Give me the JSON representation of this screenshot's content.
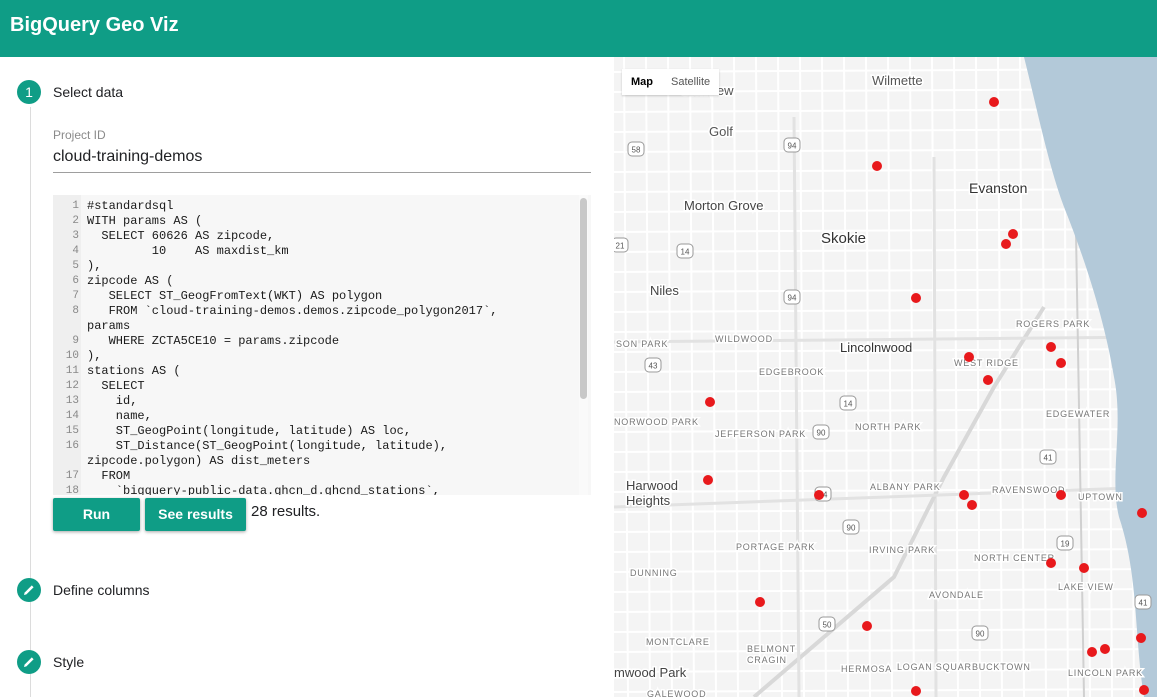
{
  "app": {
    "title": "BigQuery Geo Viz"
  },
  "steps": [
    {
      "number": "1",
      "label": "Select data"
    },
    {
      "label": "Define columns"
    },
    {
      "label": "Style"
    }
  ],
  "project": {
    "label": "Project ID",
    "value": "cloud-training-demos"
  },
  "editor": {
    "lines": [
      {
        "n": "1",
        "text": "#standardsql"
      },
      {
        "n": "2",
        "text": "WITH params AS ("
      },
      {
        "n": "3",
        "text": "  SELECT 60626 AS zipcode,"
      },
      {
        "n": "4",
        "text": "         10    AS maxdist_km"
      },
      {
        "n": "5",
        "text": "),"
      },
      {
        "n": "6",
        "text": "zipcode AS ("
      },
      {
        "n": "7",
        "text": "   SELECT ST_GeogFromText(WKT) AS polygon"
      },
      {
        "n": "8",
        "text": "   FROM `cloud-training-demos.demos.zipcode_polygon2017`,"
      },
      {
        "n": "",
        "text": "params"
      },
      {
        "n": "9",
        "text": "   WHERE ZCTA5CE10 = params.zipcode"
      },
      {
        "n": "10",
        "text": "),"
      },
      {
        "n": "11",
        "text": "stations AS ("
      },
      {
        "n": "12",
        "text": "  SELECT"
      },
      {
        "n": "13",
        "text": "    id,"
      },
      {
        "n": "14",
        "text": "    name,"
      },
      {
        "n": "15",
        "text": "    ST_GeogPoint(longitude, latitude) AS loc,"
      },
      {
        "n": "16",
        "text": "    ST_Distance(ST_GeogPoint(longitude, latitude),"
      },
      {
        "n": "",
        "text": "zipcode.polygon) AS dist_meters"
      },
      {
        "n": "17",
        "text": "  FROM"
      },
      {
        "n": "18",
        "text": "    `bigquery-public-data.ghcn_d.ghcnd_stations`,"
      }
    ]
  },
  "buttons": {
    "run": "Run",
    "see_results": "See results"
  },
  "results_text": "28 results.",
  "map": {
    "type_map": "Map",
    "type_satellite": "Satellite",
    "labels": {
      "wilmette": "Wilmette",
      "glenview": "Glenview",
      "golf": "Golf",
      "evanston": "Evanston",
      "morton_grove": "Morton Grove",
      "skokie": "Skokie",
      "niles": "Niles",
      "rogers_park": "ROGERS PARK",
      "wildwood": "WILDWOOD",
      "edison_park": "SON PARK",
      "lincolnwood": "Lincolnwood",
      "west_ridge": "WEST RIDGE",
      "edgebrook": "EDGEBROOK",
      "edgewater": "EDGEWATER",
      "norwood_park": "NORWOOD PARK",
      "jefferson_park": "JEFFERSON PARK",
      "north_park": "NORTH PARK",
      "harwood_heights": "Harwood\nHeights",
      "albany_park": "ALBANY PARK",
      "ravenswood": "RAVENSWOOD",
      "uptown": "UPTOWN",
      "portage_park": "PORTAGE PARK",
      "irving_park": "IRVING PARK",
      "north_center": "NORTH CENTER",
      "dunning": "DUNNING",
      "lake_view": "LAKE VIEW",
      "avondale": "AVONDALE",
      "montclare": "MONTCLARE",
      "belmont_cragin": "BELMONT\nCRAGIN",
      "hermosa": "HERMOSA",
      "logan_square": "LOGAN SQUARE",
      "bucktown": "BUCKTOWN",
      "lincoln_park": "LINCOLN PARK",
      "elmwood_park": "mwood Park",
      "galewood": "GALEWOOD"
    },
    "shields": {
      "r58": "58",
      "r94a": "94",
      "r21": "21",
      "r14": "14",
      "r94b": "94",
      "r43": "43",
      "r14b": "14",
      "r90a": "90",
      "r41a": "41",
      "r94c": "94",
      "r90b": "90",
      "r19": "19",
      "r41b": "41",
      "r50": "50",
      "r90c": "90"
    },
    "marker_color": "#e8191c",
    "water_color": "#b3c9d9"
  }
}
